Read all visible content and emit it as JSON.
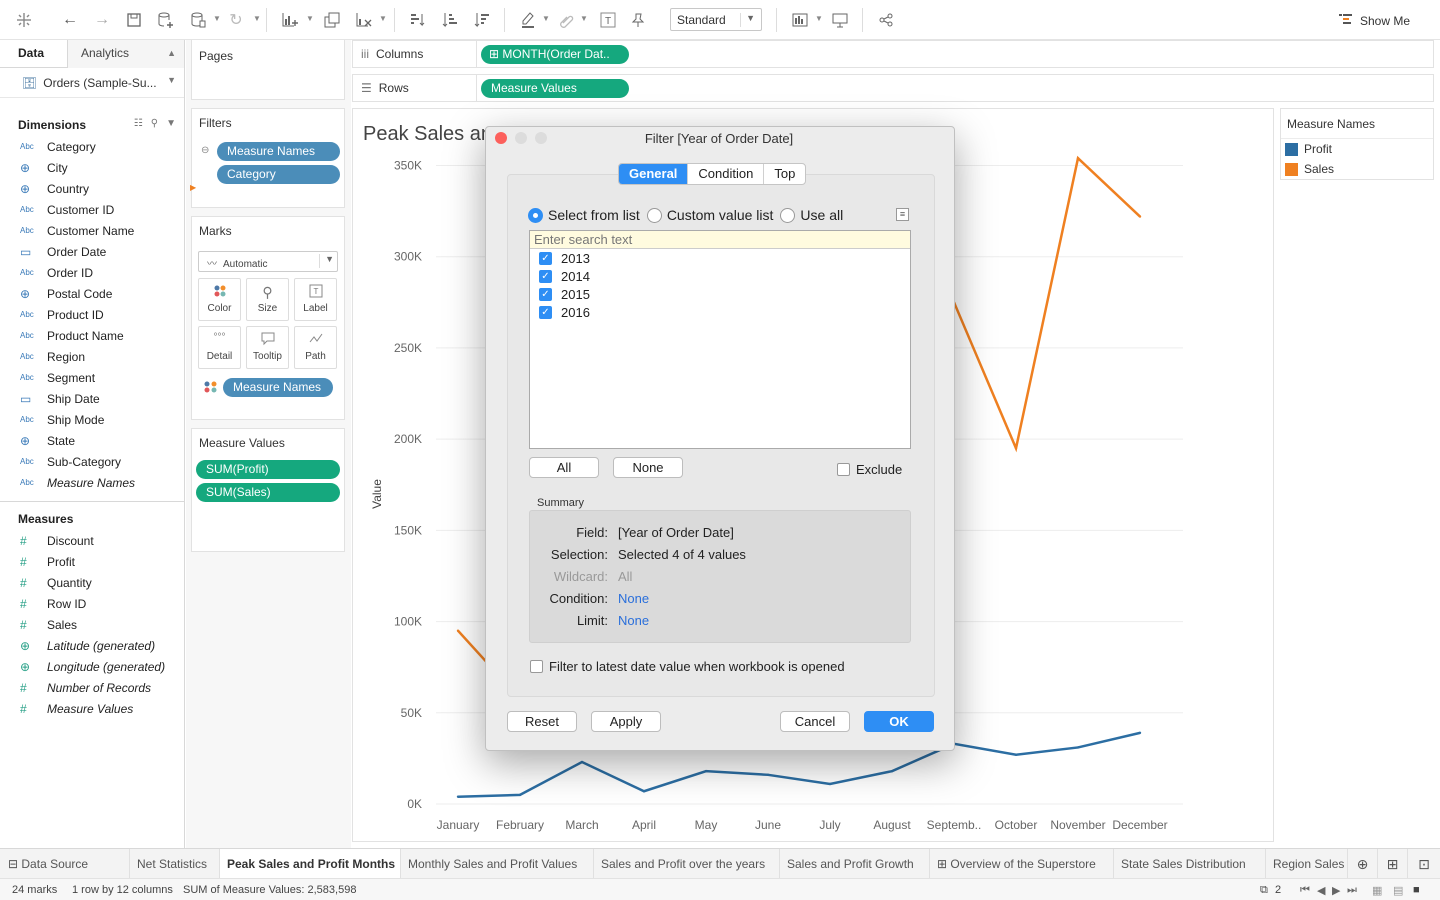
{
  "toolbar": {
    "view_select": "Standard",
    "show_me": "Show Me",
    "icons": [
      "tableau-logo-icon",
      "undo-icon",
      "redo-icon",
      "save-icon",
      "new-datasource-icon",
      "pause-updates-icon",
      "refresh-icon",
      "new-worksheet-icon",
      "duplicate-icon",
      "clear-sheet-icon",
      "swap-icon",
      "sort-ascending-icon",
      "sort-descending-icon",
      "highlight-icon",
      "group-icon",
      "labels-icon",
      "pin-icon",
      "fit-icon",
      "presentation-icon",
      "share-icon"
    ]
  },
  "datapane": {
    "tab_data": "Data",
    "tab_analytics": "Analytics",
    "datasource": "Orders (Sample-Su...",
    "dimensions_title": "Dimensions",
    "dimensions": [
      {
        "type": "Abc",
        "name": "Category",
        "italic": false
      },
      {
        "type": "glob",
        "name": "City",
        "italic": false
      },
      {
        "type": "glob",
        "name": "Country",
        "italic": false
      },
      {
        "type": "Abc",
        "name": "Customer ID",
        "italic": false
      },
      {
        "type": "Abc",
        "name": "Customer Name",
        "italic": false
      },
      {
        "type": "cal",
        "name": "Order Date",
        "italic": false
      },
      {
        "type": "Abc",
        "name": "Order ID",
        "italic": false
      },
      {
        "type": "glob",
        "name": "Postal Code",
        "italic": false
      },
      {
        "type": "Abc",
        "name": "Product ID",
        "italic": false
      },
      {
        "type": "Abc",
        "name": "Product Name",
        "italic": false
      },
      {
        "type": "Abc",
        "name": "Region",
        "italic": false
      },
      {
        "type": "Abc",
        "name": "Segment",
        "italic": false
      },
      {
        "type": "cal",
        "name": "Ship Date",
        "italic": false
      },
      {
        "type": "Abc",
        "name": "Ship Mode",
        "italic": false
      },
      {
        "type": "glob",
        "name": "State",
        "italic": false
      },
      {
        "type": "Abc",
        "name": "Sub-Category",
        "italic": false
      },
      {
        "type": "Abc",
        "name": "Measure Names",
        "italic": true
      }
    ],
    "measures_title": "Measures",
    "measures": [
      {
        "type": "hash",
        "name": "Discount",
        "italic": false
      },
      {
        "type": "hash",
        "name": "Profit",
        "italic": false
      },
      {
        "type": "hash",
        "name": "Quantity",
        "italic": false
      },
      {
        "type": "hash",
        "name": "Row ID",
        "italic": false
      },
      {
        "type": "hash",
        "name": "Sales",
        "italic": false
      },
      {
        "type": "globm",
        "name": "Latitude (generated)",
        "italic": true
      },
      {
        "type": "globm",
        "name": "Longitude (generated)",
        "italic": true
      },
      {
        "type": "hash",
        "name": "Number of Records",
        "italic": true
      },
      {
        "type": "hash",
        "name": "Measure Values",
        "italic": true
      }
    ]
  },
  "cards": {
    "pages_title": "Pages",
    "filters_title": "Filters",
    "filter_pills": [
      "Measure Names",
      "Category"
    ],
    "marks_title": "Marks",
    "mark_type": "Automatic",
    "mark_buttons": [
      "Color",
      "Size",
      "Label",
      "Detail",
      "Tooltip",
      "Path"
    ],
    "marks_pill": "Measure Names",
    "measure_values_title": "Measure Values",
    "measure_values_pills": [
      "SUM(Profit)",
      "SUM(Sales)"
    ]
  },
  "shelves": {
    "columns_label": "Columns",
    "columns_pill": "MONTH(Order Dat..",
    "rows_label": "Rows",
    "rows_pill": "Measure Values"
  },
  "chart": {
    "title": "Peak Sales an"
  },
  "chart_data": {
    "type": "line",
    "categories": [
      "January",
      "February",
      "March",
      "April",
      "May",
      "June",
      "July",
      "August",
      "Septemb..",
      "October",
      "November",
      "December"
    ],
    "ylabel": "Value",
    "yticks": [
      "0K",
      "50K",
      "100K",
      "150K",
      "200K",
      "250K",
      "300K",
      "350K"
    ],
    "ylim": [
      0,
      370000
    ],
    "series": [
      {
        "name": "Profit",
        "color": "#2c6ea3",
        "values": [
          4000,
          5000,
          23000,
          7000,
          18000,
          16000,
          11000,
          18000,
          33000,
          27000,
          31000,
          39000
        ]
      },
      {
        "name": "Sales",
        "color": "#ef8021",
        "values": [
          95000,
          null,
          null,
          null,
          null,
          null,
          null,
          null,
          275000,
          195000,
          354000,
          322000
        ]
      }
    ]
  },
  "legend": {
    "title": "Measure Names",
    "items": [
      {
        "name": "Profit",
        "color": "#2c6ea3"
      },
      {
        "name": "Sales",
        "color": "#ef8021"
      }
    ]
  },
  "dialog": {
    "title": "Filter [Year of Order Date]",
    "tabs": [
      "General",
      "Condition",
      "Top"
    ],
    "radio_options": [
      "Select from list",
      "Custom value list",
      "Use all"
    ],
    "search_placeholder": "Enter search text",
    "list_items": [
      "2013",
      "2014",
      "2015",
      "2016"
    ],
    "btn_all": "All",
    "btn_none": "None",
    "exclude_label": "Exclude",
    "summary_title": "Summary",
    "summary": {
      "field_k": "Field:",
      "field_v": "[Year of Order Date]",
      "selection_k": "Selection:",
      "selection_v": "Selected 4 of 4 values",
      "wildcard_k": "Wildcard:",
      "wildcard_v": "All",
      "condition_k": "Condition:",
      "condition_v": "None",
      "limit_k": "Limit:",
      "limit_v": "None"
    },
    "latest_label": "Filter to latest date value when workbook is opened",
    "btn_reset": "Reset",
    "btn_apply": "Apply",
    "btn_cancel": "Cancel",
    "btn_ok": "OK"
  },
  "sheettabs": {
    "datasource": "Data Source",
    "tabs": [
      "Net Statistics",
      "Peak Sales and Profit Months",
      "Monthly Sales and Profit Values",
      "Sales and Profit over the years",
      "Sales and Profit Growth",
      "Overview of the Superstore",
      "State Sales Distribution",
      "Region Sales"
    ]
  },
  "status": {
    "marks": "24 marks",
    "rows_cols": "1 row by 12 columns",
    "sum": "SUM of Measure Values: 2,583,598",
    "page": "2"
  }
}
